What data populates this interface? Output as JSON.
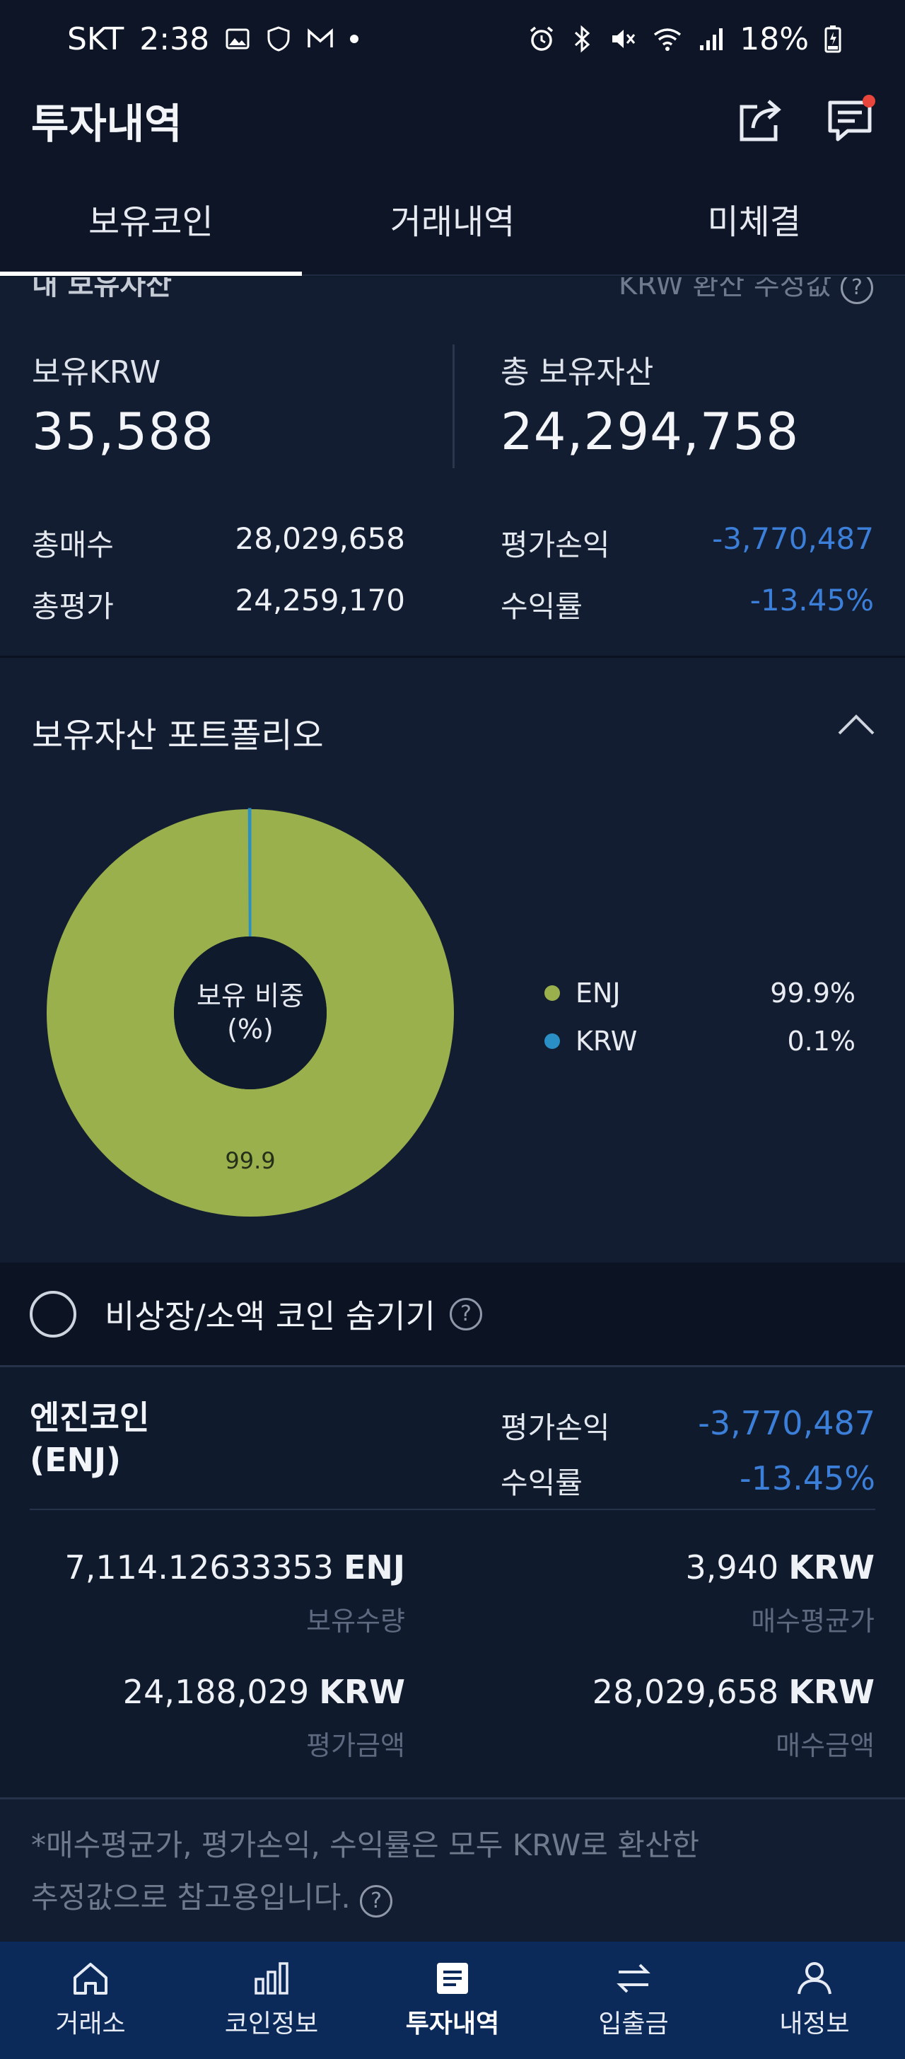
{
  "status_bar": {
    "carrier": "SKT",
    "time": "2:38",
    "battery": "18%"
  },
  "app_bar": {
    "title": "투자내역"
  },
  "tabs": [
    {
      "label": "보유코인",
      "active": true
    },
    {
      "label": "거래내역",
      "active": false
    },
    {
      "label": "미체결",
      "active": false
    }
  ],
  "summary": {
    "section_title": "내 보유자산",
    "conversion_note": "KRW 환산 추정값",
    "krw_label": "보유KRW",
    "krw_value": "35,588",
    "total_label": "총 보유자산",
    "total_value": "24,294,758",
    "buy_total_label": "총매수",
    "buy_total_value": "28,029,658",
    "eval_total_label": "총평가",
    "eval_total_value": "24,259,170",
    "pnl_label": "평가손익",
    "pnl_value": "-3,770,487",
    "return_label": "수익률",
    "return_value": "-13.45%"
  },
  "portfolio": {
    "title": "보유자산 포트폴리오",
    "center_label_1": "보유 비중",
    "center_label_2": "(%)",
    "slice_label": "99.9",
    "legend": [
      {
        "name": "ENJ",
        "percent": "99.9%",
        "color": "#9ab04c"
      },
      {
        "name": "KRW",
        "percent": "0.1%",
        "color": "#2a8fc4"
      }
    ]
  },
  "chart_data": {
    "type": "pie",
    "categories": [
      "ENJ",
      "KRW"
    ],
    "values": [
      99.9,
      0.1
    ],
    "title": "보유 비중 (%)"
  },
  "hide_option": {
    "label": "비상장/소액 코인 숨기기"
  },
  "coin": {
    "name_line1": "엔진코인",
    "name_line2": "(ENJ)",
    "pnl_label": "평가손익",
    "pnl_value": "-3,770,487",
    "return_label": "수익률",
    "return_value": "-13.45%",
    "qty_value": "7,114.12633353",
    "qty_unit": "ENJ",
    "qty_label": "보유수량",
    "avg_value": "3,940",
    "avg_unit": "KRW",
    "avg_label": "매수평균가",
    "eval_value": "24,188,029",
    "eval_unit": "KRW",
    "eval_label": "평가금액",
    "buy_value": "28,029,658",
    "buy_unit": "KRW",
    "buy_label": "매수금액"
  },
  "footnote": {
    "line1": "*매수평균가, 평가손익, 수익률은 모두 KRW로 환산한",
    "line2": "추정값으로 참고용입니다."
  },
  "bottom_nav": [
    {
      "label": "거래소",
      "icon": "home-icon",
      "active": false
    },
    {
      "label": "코인정보",
      "icon": "bar-chart-icon",
      "active": false
    },
    {
      "label": "투자내역",
      "icon": "document-icon",
      "active": true
    },
    {
      "label": "입출금",
      "icon": "transfer-icon",
      "active": false
    },
    {
      "label": "내정보",
      "icon": "user-icon",
      "active": false
    }
  ],
  "colors": {
    "background": "#0f1a2d",
    "negative": "#3b7fd9",
    "nav_background": "#0b2a5a"
  }
}
